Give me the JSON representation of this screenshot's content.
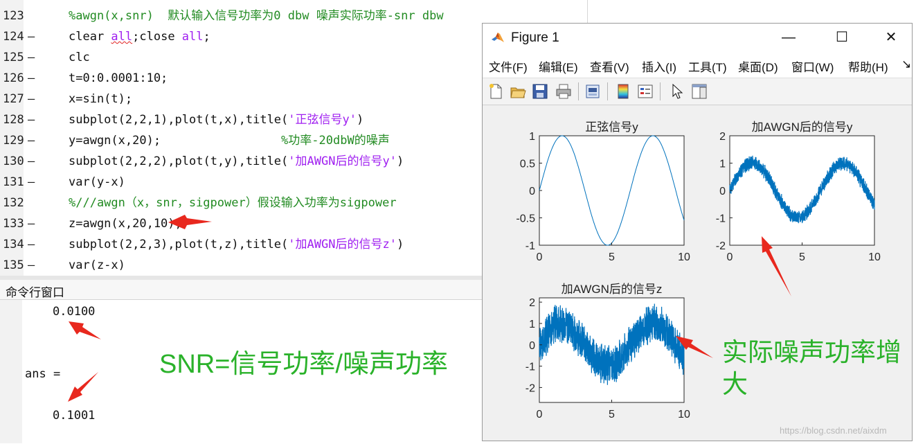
{
  "editor": {
    "lines": [
      {
        "num": "123",
        "dash": "",
        "parts": [
          {
            "t": "%awgn(x,snr)  默认输入信号功率为0 dbw 噪声实际功率-snr dbw",
            "c": "c-comment"
          }
        ]
      },
      {
        "num": "124",
        "dash": "—",
        "parts": [
          {
            "t": "clear ",
            "c": "c-code"
          },
          {
            "t": "all",
            "c": "kw squig"
          },
          {
            "t": ";close ",
            "c": "c-code"
          },
          {
            "t": "all",
            "c": "kw"
          },
          {
            "t": ";",
            "c": "c-code"
          }
        ]
      },
      {
        "num": "125",
        "dash": "—",
        "parts": [
          {
            "t": "clc",
            "c": "c-code"
          }
        ]
      },
      {
        "num": "126",
        "dash": "—",
        "parts": [
          {
            "t": "t=0:0.0001:10;",
            "c": "c-code"
          }
        ]
      },
      {
        "num": "127",
        "dash": "—",
        "parts": [
          {
            "t": "x=sin(t);",
            "c": "c-code"
          }
        ]
      },
      {
        "num": "128",
        "dash": "—",
        "parts": [
          {
            "t": "subplot(2,2,1),plot(t,x),title(",
            "c": "c-code"
          },
          {
            "t": "'正弦信号y'",
            "c": "str"
          },
          {
            "t": ")",
            "c": "c-code"
          }
        ]
      },
      {
        "num": "129",
        "dash": "—",
        "parts": [
          {
            "t": "y=awgn(x,20);                 ",
            "c": "c-code"
          },
          {
            "t": "%功率-20dbW的噪声",
            "c": "c-comment"
          }
        ]
      },
      {
        "num": "130",
        "dash": "—",
        "parts": [
          {
            "t": "subplot(2,2,2),plot(t,y),title(",
            "c": "c-code"
          },
          {
            "t": "'加AWGN后的信号y'",
            "c": "str"
          },
          {
            "t": ")",
            "c": "c-code"
          }
        ]
      },
      {
        "num": "131",
        "dash": "—",
        "parts": [
          {
            "t": "var(y-x)",
            "c": "c-code"
          }
        ]
      },
      {
        "num": "132",
        "dash": "",
        "parts": [
          {
            "t": "%///awgn（x，snr，sigpower）假设输入功率为sigpower",
            "c": "c-comment"
          }
        ]
      },
      {
        "num": "133",
        "dash": "—",
        "parts": [
          {
            "t": "z=awgn(x,20,10);",
            "c": "c-code"
          }
        ]
      },
      {
        "num": "134",
        "dash": "—",
        "parts": [
          {
            "t": "subplot(2,2,3),plot(t,z),title(",
            "c": "c-code"
          },
          {
            "t": "'加AWGN后的信号z'",
            "c": "str"
          },
          {
            "t": ")",
            "c": "c-code"
          }
        ]
      },
      {
        "num": "135",
        "dash": "—",
        "parts": [
          {
            "t": "var(z-x)",
            "c": "c-code"
          }
        ]
      }
    ]
  },
  "command_window": {
    "title": "命令行窗口",
    "out1": "0.0100",
    "ans": "ans =",
    "out2": "0.1001"
  },
  "annotations": {
    "snr": "SNR=信号功率/噪声功率",
    "noise_line1": "实际噪声功率增",
    "noise_line2": "大",
    "watermark": "https://blog.csdn.net/aixdm",
    "arrow_color": "#e8281e",
    "text_color": "#2ab22a"
  },
  "figure": {
    "title": "Figure 1",
    "menu": [
      "文件(F)",
      "编辑(E)",
      "查看(V)",
      "插入(I)",
      "工具(T)",
      "桌面(D)",
      "窗口(W)",
      "帮助(H)"
    ],
    "menu_overflow": "↘",
    "win_controls": {
      "minimize": "—",
      "maximize": "☐",
      "close": "✕"
    },
    "toolbar_icons": [
      "new-figure-icon",
      "open-file-icon",
      "save-icon",
      "print-icon",
      "print-preview-icon",
      "colorbar-icon",
      "legend-icon",
      "pointer-icon",
      "property-editor-icon"
    ]
  },
  "chart_data": [
    {
      "type": "line",
      "title": "正弦信号y",
      "x": [
        0,
        1.571,
        3.142,
        4.712,
        6.283,
        7.854,
        9.425,
        10
      ],
      "series": [
        {
          "values": [
            0,
            1,
            0,
            -1,
            0,
            1,
            0,
            -0.544
          ]
        }
      ],
      "xlim": [
        0,
        10
      ],
      "ylim": [
        -1,
        1
      ],
      "xticks": [
        "0",
        "5",
        "10"
      ],
      "yticks": [
        "1",
        "0.5",
        "0",
        "-0.5",
        "-1"
      ],
      "noise_amplitude": 0,
      "color": "#0072bd",
      "grid": false
    },
    {
      "type": "line",
      "title": "加AWGN后的信号y",
      "x": [
        0,
        1.571,
        3.142,
        4.712,
        6.283,
        7.854,
        9.425,
        10
      ],
      "series": [
        {
          "values": [
            0,
            1,
            0,
            -1,
            0,
            1,
            0,
            -0.544
          ]
        }
      ],
      "xlim": [
        0,
        10
      ],
      "ylim": [
        -2,
        2
      ],
      "xticks": [
        "0",
        "5",
        "10"
      ],
      "yticks": [
        "2",
        "1",
        "0",
        "-1",
        "-2"
      ],
      "noise_amplitude": 0.3,
      "color": "#0072bd",
      "grid": false
    },
    {
      "type": "line",
      "title": "加AWGN后的信号z",
      "x": [
        0,
        1.571,
        3.142,
        4.712,
        6.283,
        7.854,
        9.425,
        10
      ],
      "series": [
        {
          "values": [
            0,
            1,
            0,
            -1,
            0,
            1,
            0,
            -0.544
          ]
        }
      ],
      "xlim": [
        0,
        10
      ],
      "ylim": [
        -2.7,
        2.2
      ],
      "xticks": [
        "0",
        "5",
        "10"
      ],
      "yticks": [
        "2",
        "1",
        "0",
        "-1",
        "-2"
      ],
      "noise_amplitude": 1.0,
      "color": "#0072bd",
      "grid": false
    }
  ]
}
